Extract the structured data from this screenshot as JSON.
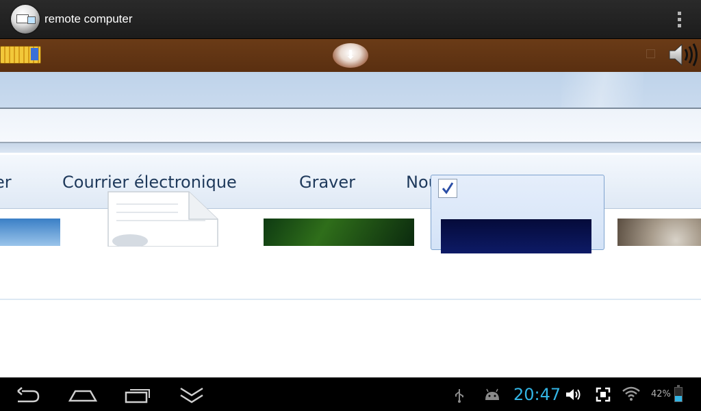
{
  "app_bar": {
    "title": "remote computer",
    "icons": [
      "remote-computer-app-icon",
      "overflow-menu-icon"
    ]
  },
  "toolbar": {
    "icons": [
      "keyboard-icon",
      "download-arrow-icon",
      "small-square-icon",
      "speaker-icon"
    ],
    "background_color": "#5a2f10"
  },
  "remote_window": {
    "command_bar": {
      "items": [
        "er",
        "Courrier électronique",
        "Graver",
        "Nouveau dossier"
      ]
    },
    "content": {
      "tiles": [
        "image-thumbnail",
        "document-icon",
        "image-thumbnail",
        "selected-image-thumbnail",
        "image-thumbnail"
      ],
      "selected_tile_checked": true
    }
  },
  "status_bar": {
    "time": "20:47",
    "battery_percent": "42%",
    "battery_level": 0.42,
    "clock_color": "#33b5e5",
    "icons": [
      "usb-icon",
      "android-debug-icon",
      "volume-icon",
      "screenshot-icon",
      "wifi-icon",
      "battery-icon"
    ]
  },
  "nav_bar": {
    "buttons": [
      "back-button",
      "home-button",
      "recent-apps-button",
      "hide-keyboard-button"
    ]
  }
}
